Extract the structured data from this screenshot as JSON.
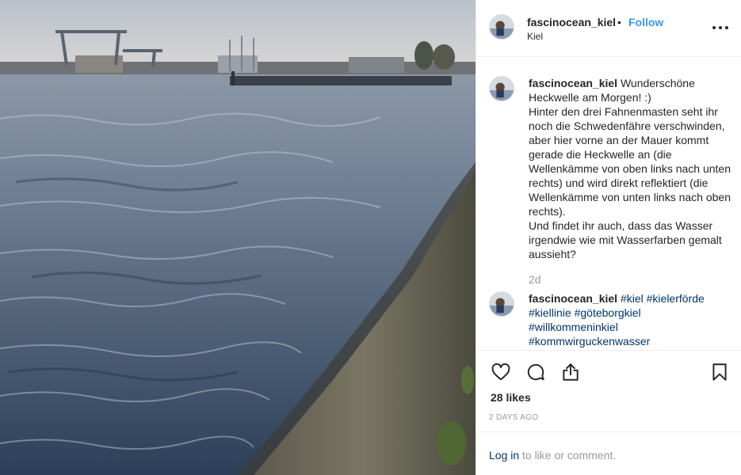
{
  "post": {
    "username": "fascinocean_kiel",
    "separator": "•",
    "follow_label": "Follow",
    "location": "Kiel"
  },
  "caption": {
    "username": "fascinocean_kiel",
    "text_first": "Wunderschöne Heckwelle am Morgen! :)",
    "lines": [
      "Hinter den drei Fahnenmasten seht ihr noch die Schwedenfähre verschwinden, aber hier vorne an der Mauer kommt gerade die Heckwelle an (die Wellenkämme von oben links nach unten rechts) und wird direkt reflektiert (die Wellenkämme von unten links nach oben rechts).",
      "Und findet ihr auch, dass das Wasser irgendwie wie mit Wasserfarben gemalt aussieht?"
    ],
    "time": "2d"
  },
  "tags_comment": {
    "username": "fascinocean_kiel",
    "tags": [
      "#kiel",
      "#kielerförde",
      "#kiellinie",
      "#göteborgkiel",
      "#willkommeninkiel",
      "#kommwirguckenwasser"
    ]
  },
  "stats": {
    "likes": "28 likes",
    "ago": "2 DAYS AGO"
  },
  "login": {
    "link": "Log in",
    "rest": "to like or comment."
  },
  "icons": {
    "like": "heart-icon",
    "comment": "comment-icon",
    "share": "share-icon",
    "save": "bookmark-icon",
    "more": "more-options-icon"
  },
  "colors": {
    "accent": "#3897f0",
    "link": "#003569",
    "muted": "#999999",
    "text": "#262626"
  }
}
